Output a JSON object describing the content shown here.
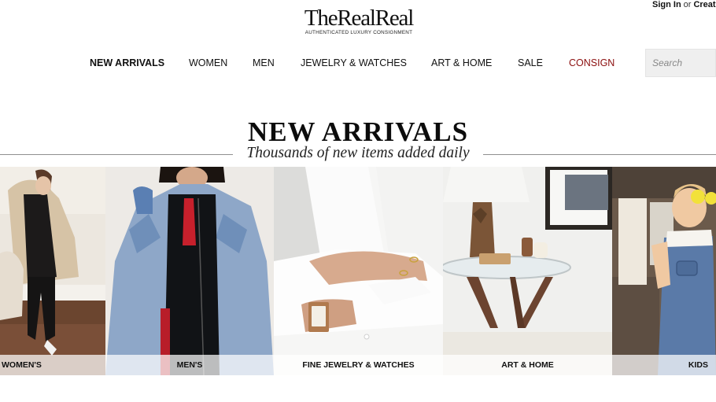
{
  "header": {
    "sign_in": "Sign In",
    "or": "or",
    "create": "Create Account",
    "logo": "TheRealReal",
    "tagline": "AUTHENTICATED LUXURY CONSIGNMENT"
  },
  "nav": [
    {
      "label": "NEW ARRIVALS"
    },
    {
      "label": "WOMEN"
    },
    {
      "label": "MEN"
    },
    {
      "label": "JEWELRY & WATCHES"
    },
    {
      "label": "ART & HOME"
    },
    {
      "label": "SALE"
    },
    {
      "label": "CONSIGN"
    }
  ],
  "search": {
    "placeholder": "Search"
  },
  "hero": {
    "title": "NEW ARRIVALS",
    "subtitle": "Thousands of new items added daily"
  },
  "tiles": [
    {
      "label": "WOMEN'S"
    },
    {
      "label": "MEN'S"
    },
    {
      "label": "FINE JEWELRY & WATCHES"
    },
    {
      "label": "ART & HOME"
    },
    {
      "label": "KIDS"
    }
  ],
  "colors": {
    "consign": "#8b0e0e",
    "search_bg": "#efefef",
    "label_bg": "rgba(255,255,255,0.72)"
  }
}
